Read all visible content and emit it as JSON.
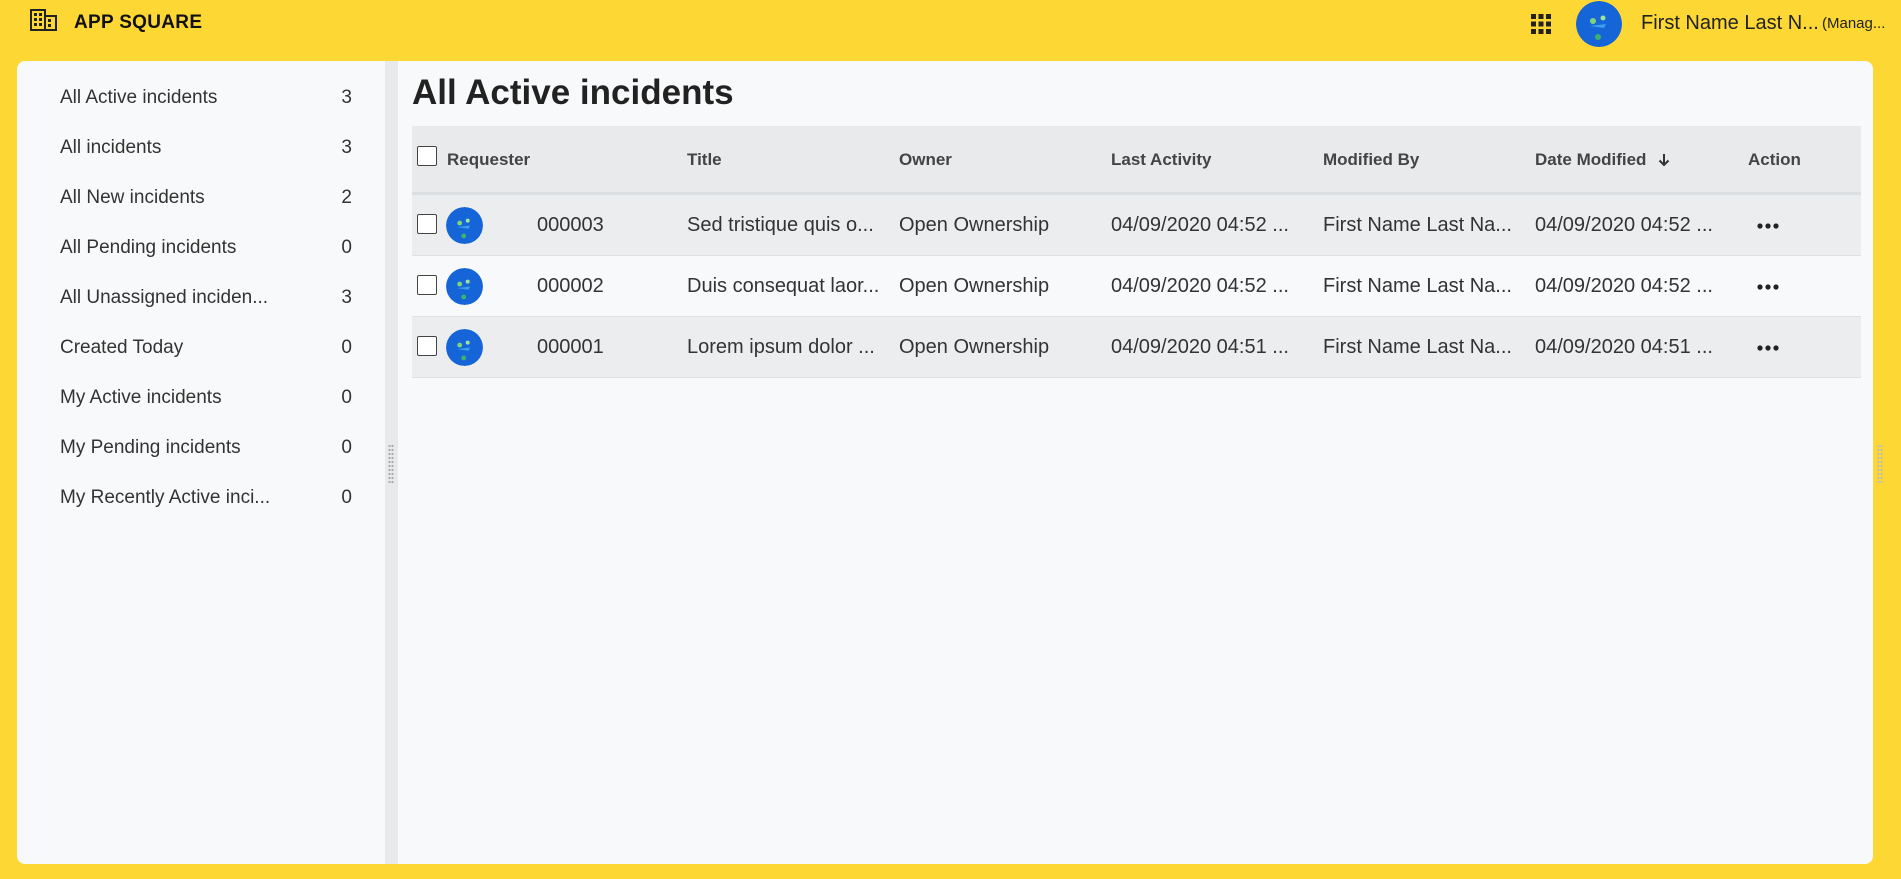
{
  "header": {
    "app_title": "APP SQUARE",
    "logo_icon": "building-icon",
    "apps_icon": "apps-grid-icon",
    "user_name": "First Name Last N...",
    "user_role": "(Manag..."
  },
  "sidebar": {
    "items": [
      {
        "label": "All Active incidents",
        "count": "3"
      },
      {
        "label": "All incidents",
        "count": "3"
      },
      {
        "label": "All New incidents",
        "count": "2"
      },
      {
        "label": "All Pending incidents",
        "count": "0"
      },
      {
        "label": "All Unassigned inciden...",
        "count": "3"
      },
      {
        "label": "Created Today",
        "count": "0"
      },
      {
        "label": "My Active incidents",
        "count": "0"
      },
      {
        "label": "My Pending incidents",
        "count": "0"
      },
      {
        "label": "My Recently Active inci...",
        "count": "0"
      }
    ]
  },
  "main": {
    "title": "All Active incidents",
    "columns": {
      "requester": "Requester",
      "title": "Title",
      "owner": "Owner",
      "last_activity": "Last Activity",
      "modified_by": "Modified By",
      "date_modified": "Date Modified",
      "action": "Action"
    },
    "sort_icon": "arrow-down-icon",
    "rows": [
      {
        "id": "000003",
        "title": "Sed tristique quis o...",
        "owner": "Open Ownership",
        "last_activity": "04/09/2020 04:52 ...",
        "modified_by": "First Name Last Na...",
        "date_modified": "04/09/2020 04:52 ..."
      },
      {
        "id": "000002",
        "title": "Duis consequat laor...",
        "owner": "Open Ownership",
        "last_activity": "04/09/2020 04:52 ...",
        "modified_by": "First Name Last Na...",
        "date_modified": "04/09/2020 04:52 ..."
      },
      {
        "id": "000001",
        "title": "Lorem ipsum dolor ...",
        "owner": "Open Ownership",
        "last_activity": "04/09/2020 04:51 ...",
        "modified_by": "First Name Last Na...",
        "date_modified": "04/09/2020 04:51 ..."
      }
    ]
  },
  "colors": {
    "brand_yellow": "#fdd835",
    "panel_bg": "#f8f9fa",
    "avatar_blue": "#1565d8"
  }
}
